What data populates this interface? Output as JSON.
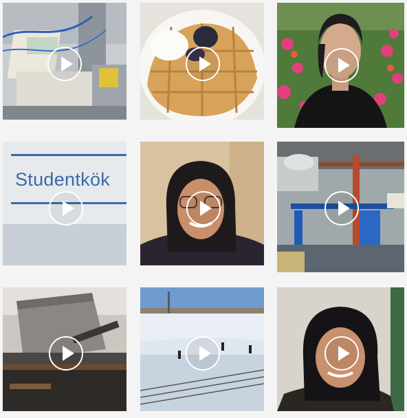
{
  "grid": {
    "tiles": [
      {
        "id": "lab-machine",
        "sign_text": ""
      },
      {
        "id": "waffles",
        "sign_text": ""
      },
      {
        "id": "woman-flowers",
        "sign_text": ""
      },
      {
        "id": "studentkok-sign",
        "sign_text": "Studentkök"
      },
      {
        "id": "woman-glasses",
        "sign_text": ""
      },
      {
        "id": "industrial-lab",
        "sign_text": ""
      },
      {
        "id": "conveyor-machine",
        "sign_text": ""
      },
      {
        "id": "ice-skating",
        "sign_text": ""
      },
      {
        "id": "woman-smiling",
        "sign_text": ""
      }
    ]
  },
  "icons": {
    "play": "play-icon"
  },
  "colors": {
    "background": "#f4f4f4",
    "play_icon": "#ffffff",
    "sign_blue": "#3b6aa8"
  }
}
